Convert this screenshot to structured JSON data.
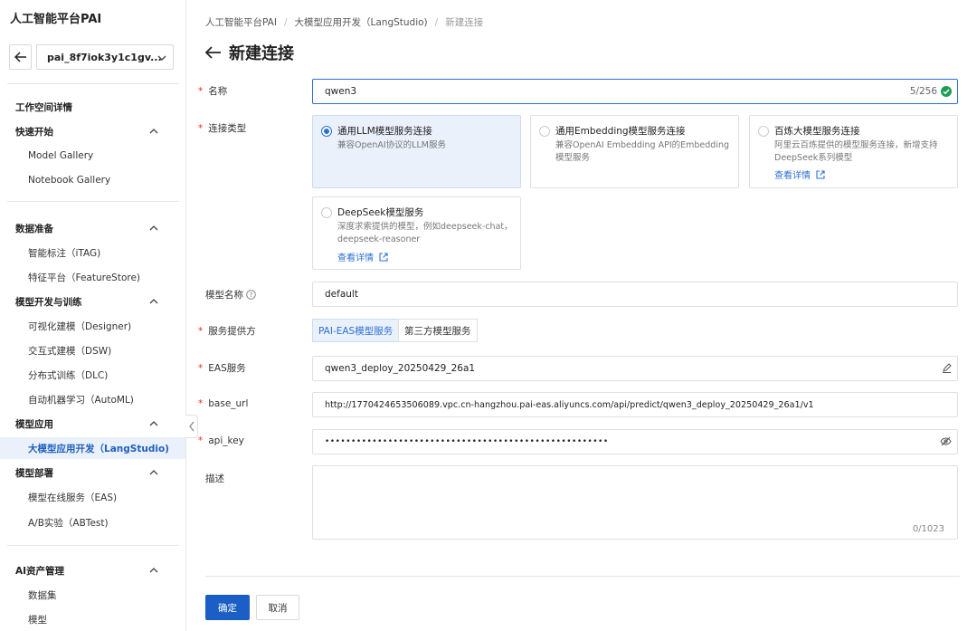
{
  "app": {
    "title": "人工智能平台PAI"
  },
  "workspace": {
    "selected": "pai_8f7iok3y1c1gv..."
  },
  "sidebar": {
    "workspace_details": "工作空间详情",
    "groups": [
      {
        "label": "快速开始",
        "items": [
          "Model Gallery",
          "Notebook Gallery"
        ]
      },
      {
        "label": "数据准备",
        "items": [
          "智能标注（iTAG)",
          "特征平台（FeatureStore)"
        ]
      },
      {
        "label": "模型开发与训练",
        "items": [
          "可视化建模（Designer)",
          "交互式建模（DSW)",
          "分布式训练（DLC)",
          "自动机器学习（AutoML)"
        ]
      },
      {
        "label": "模型应用",
        "items": [
          "大模型应用开发（LangStudio)"
        ]
      },
      {
        "label": "模型部署",
        "items": [
          "模型在线服务（EAS)",
          "A/B实验（ABTest)"
        ]
      },
      {
        "label": "AI资产管理",
        "items": [
          "数据集",
          "模型"
        ]
      }
    ],
    "active_item": "大模型应用开发（LangStudio)"
  },
  "breadcrumb": [
    "人工智能平台PAI",
    "大模型应用开发（LangStudio)",
    "新建连接"
  ],
  "page": {
    "title": "新建连接"
  },
  "form": {
    "name": {
      "label": "名称",
      "value": "qwen3",
      "count": "5/256"
    },
    "connection_type": {
      "label": "连接类型",
      "options": [
        {
          "title": "通用LLM模型服务连接",
          "desc": "兼容OpenAI协议的LLM服务",
          "link": ""
        },
        {
          "title": "通用Embedding模型服务连接",
          "desc": "兼容OpenAI Embedding API的Embedding模型服务",
          "link": ""
        },
        {
          "title": "百炼大模型服务连接",
          "desc": "阿里云百炼提供的模型服务连接，新增支持DeepSeek系列模型",
          "link": "查看详情"
        },
        {
          "title": "DeepSeek模型服务",
          "desc": "深度求索提供的模型，例如deepseek-chat，deepseek-reasoner",
          "link": "查看详情"
        }
      ]
    },
    "model_name": {
      "label": "模型名称",
      "value": "default"
    },
    "provider": {
      "label": "服务提供方",
      "options": [
        "PAI-EAS模型服务",
        "第三方模型服务"
      ]
    },
    "eas_service": {
      "label": "EAS服务",
      "value": "qwen3_deploy_20250429_26a1"
    },
    "base_url": {
      "label": "base_url",
      "value": "http://1770424653506089.vpc.cn-hangzhou.pai-eas.aliyuncs.com/api/predict/qwen3_deploy_20250429_26a1/v1"
    },
    "api_key": {
      "label": "api_key",
      "value": "••••••••••••••••••••••••••••••••••••••••••••••••••••••"
    },
    "description": {
      "label": "描述",
      "count": "0/1023"
    }
  },
  "buttons": {
    "confirm": "确定",
    "cancel": "取消"
  },
  "colors": {
    "primary": "#1b5fc6",
    "link": "#2b6fd6",
    "required": "#e0301e",
    "success": "#1f9d55"
  }
}
